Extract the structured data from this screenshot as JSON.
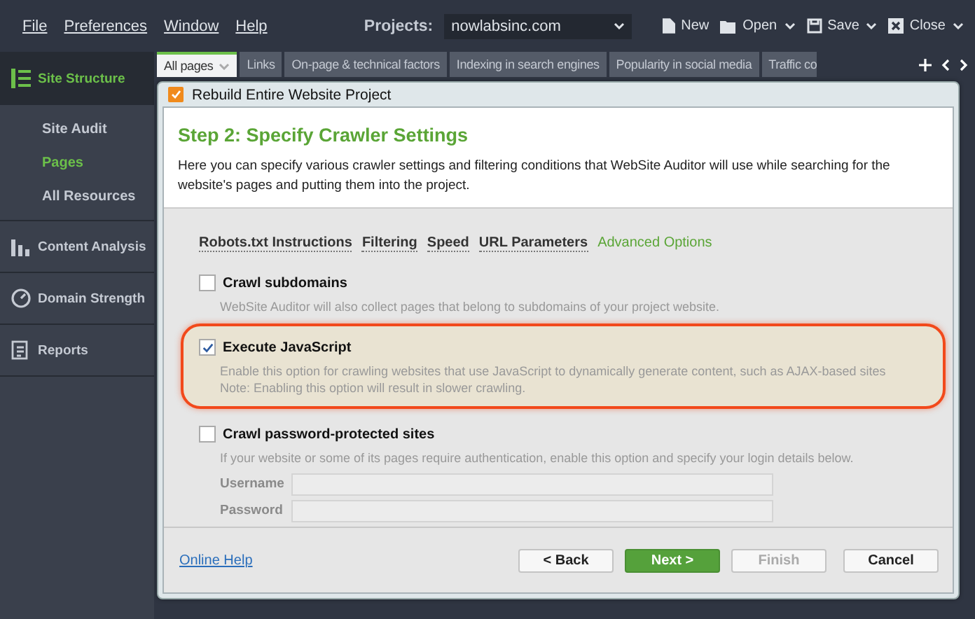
{
  "menu": [
    "File",
    "Preferences",
    "Window",
    "Help"
  ],
  "projects": {
    "label": "Projects:",
    "value": "nowlabsinc.com"
  },
  "toolbar": [
    {
      "label": "New",
      "kind": "new",
      "dropdown": false
    },
    {
      "label": "Open",
      "kind": "open",
      "dropdown": true
    },
    {
      "label": "Save",
      "kind": "save",
      "dropdown": true
    },
    {
      "label": "Close",
      "kind": "close",
      "dropdown": true
    }
  ],
  "sidebar": {
    "items": [
      {
        "label": "Site Structure",
        "kind": "structure",
        "expanded": true,
        "children": [
          {
            "label": "Site Audit",
            "selected": false
          },
          {
            "label": "Pages",
            "selected": true
          },
          {
            "label": "All Resources",
            "selected": false
          }
        ]
      },
      {
        "label": "Content Analysis",
        "kind": "content",
        "expanded": false
      },
      {
        "label": "Domain Strength",
        "kind": "domain",
        "expanded": false
      },
      {
        "label": "Reports",
        "kind": "reports",
        "expanded": false
      }
    ]
  },
  "tabs": [
    {
      "label": "All pages",
      "selected": true
    },
    {
      "label": "Links",
      "selected": false
    },
    {
      "label": "On-page & technical factors",
      "selected": false
    },
    {
      "label": "Indexing in search engines",
      "selected": false
    },
    {
      "label": "Popularity in social media",
      "selected": false
    },
    {
      "label": "Traffic co",
      "selected": false
    }
  ],
  "dialog": {
    "title": "Rebuild Entire Website Project",
    "step_title": "Step 2: Specify Crawler Settings",
    "description": "Here you can specify various crawler settings and filtering conditions that WebSite Auditor will use while searching for the website's pages and putting them into the project.",
    "subtabs": [
      {
        "label": "Robots.txt Instructions",
        "selected": false
      },
      {
        "label": "Filtering",
        "selected": false
      },
      {
        "label": "Speed",
        "selected": false
      },
      {
        "label": "URL Parameters",
        "selected": false
      },
      {
        "label": "Advanced Options",
        "selected": true
      }
    ],
    "options": [
      {
        "label": "Crawl subdomains",
        "checked": false,
        "highlighted": false,
        "description": [
          "WebSite Auditor will also collect pages that belong to subdomains of your project website."
        ]
      },
      {
        "label": "Execute JavaScript",
        "checked": true,
        "highlighted": true,
        "description": [
          "Enable this option for crawling websites that use JavaScript to dynamically generate content, such as AJAX-based sites",
          "Note: Enabling this option will result in slower crawling."
        ]
      },
      {
        "label": "Crawl password-protected sites",
        "checked": false,
        "highlighted": false,
        "description": [
          "If your website or some of its pages require authentication, enable this option and specify your login details below."
        ]
      }
    ],
    "fields": [
      {
        "label": "Username",
        "disabled": true
      },
      {
        "label": "Password",
        "disabled": true
      }
    ],
    "help_link": "Online Help",
    "buttons": [
      {
        "label": "< Back",
        "kind": "default",
        "disabled": false
      },
      {
        "label": "Next >",
        "kind": "primary",
        "disabled": false
      },
      {
        "label": "Finish",
        "kind": "default",
        "disabled": true
      },
      {
        "label": "Cancel",
        "kind": "default",
        "disabled": false
      }
    ]
  }
}
